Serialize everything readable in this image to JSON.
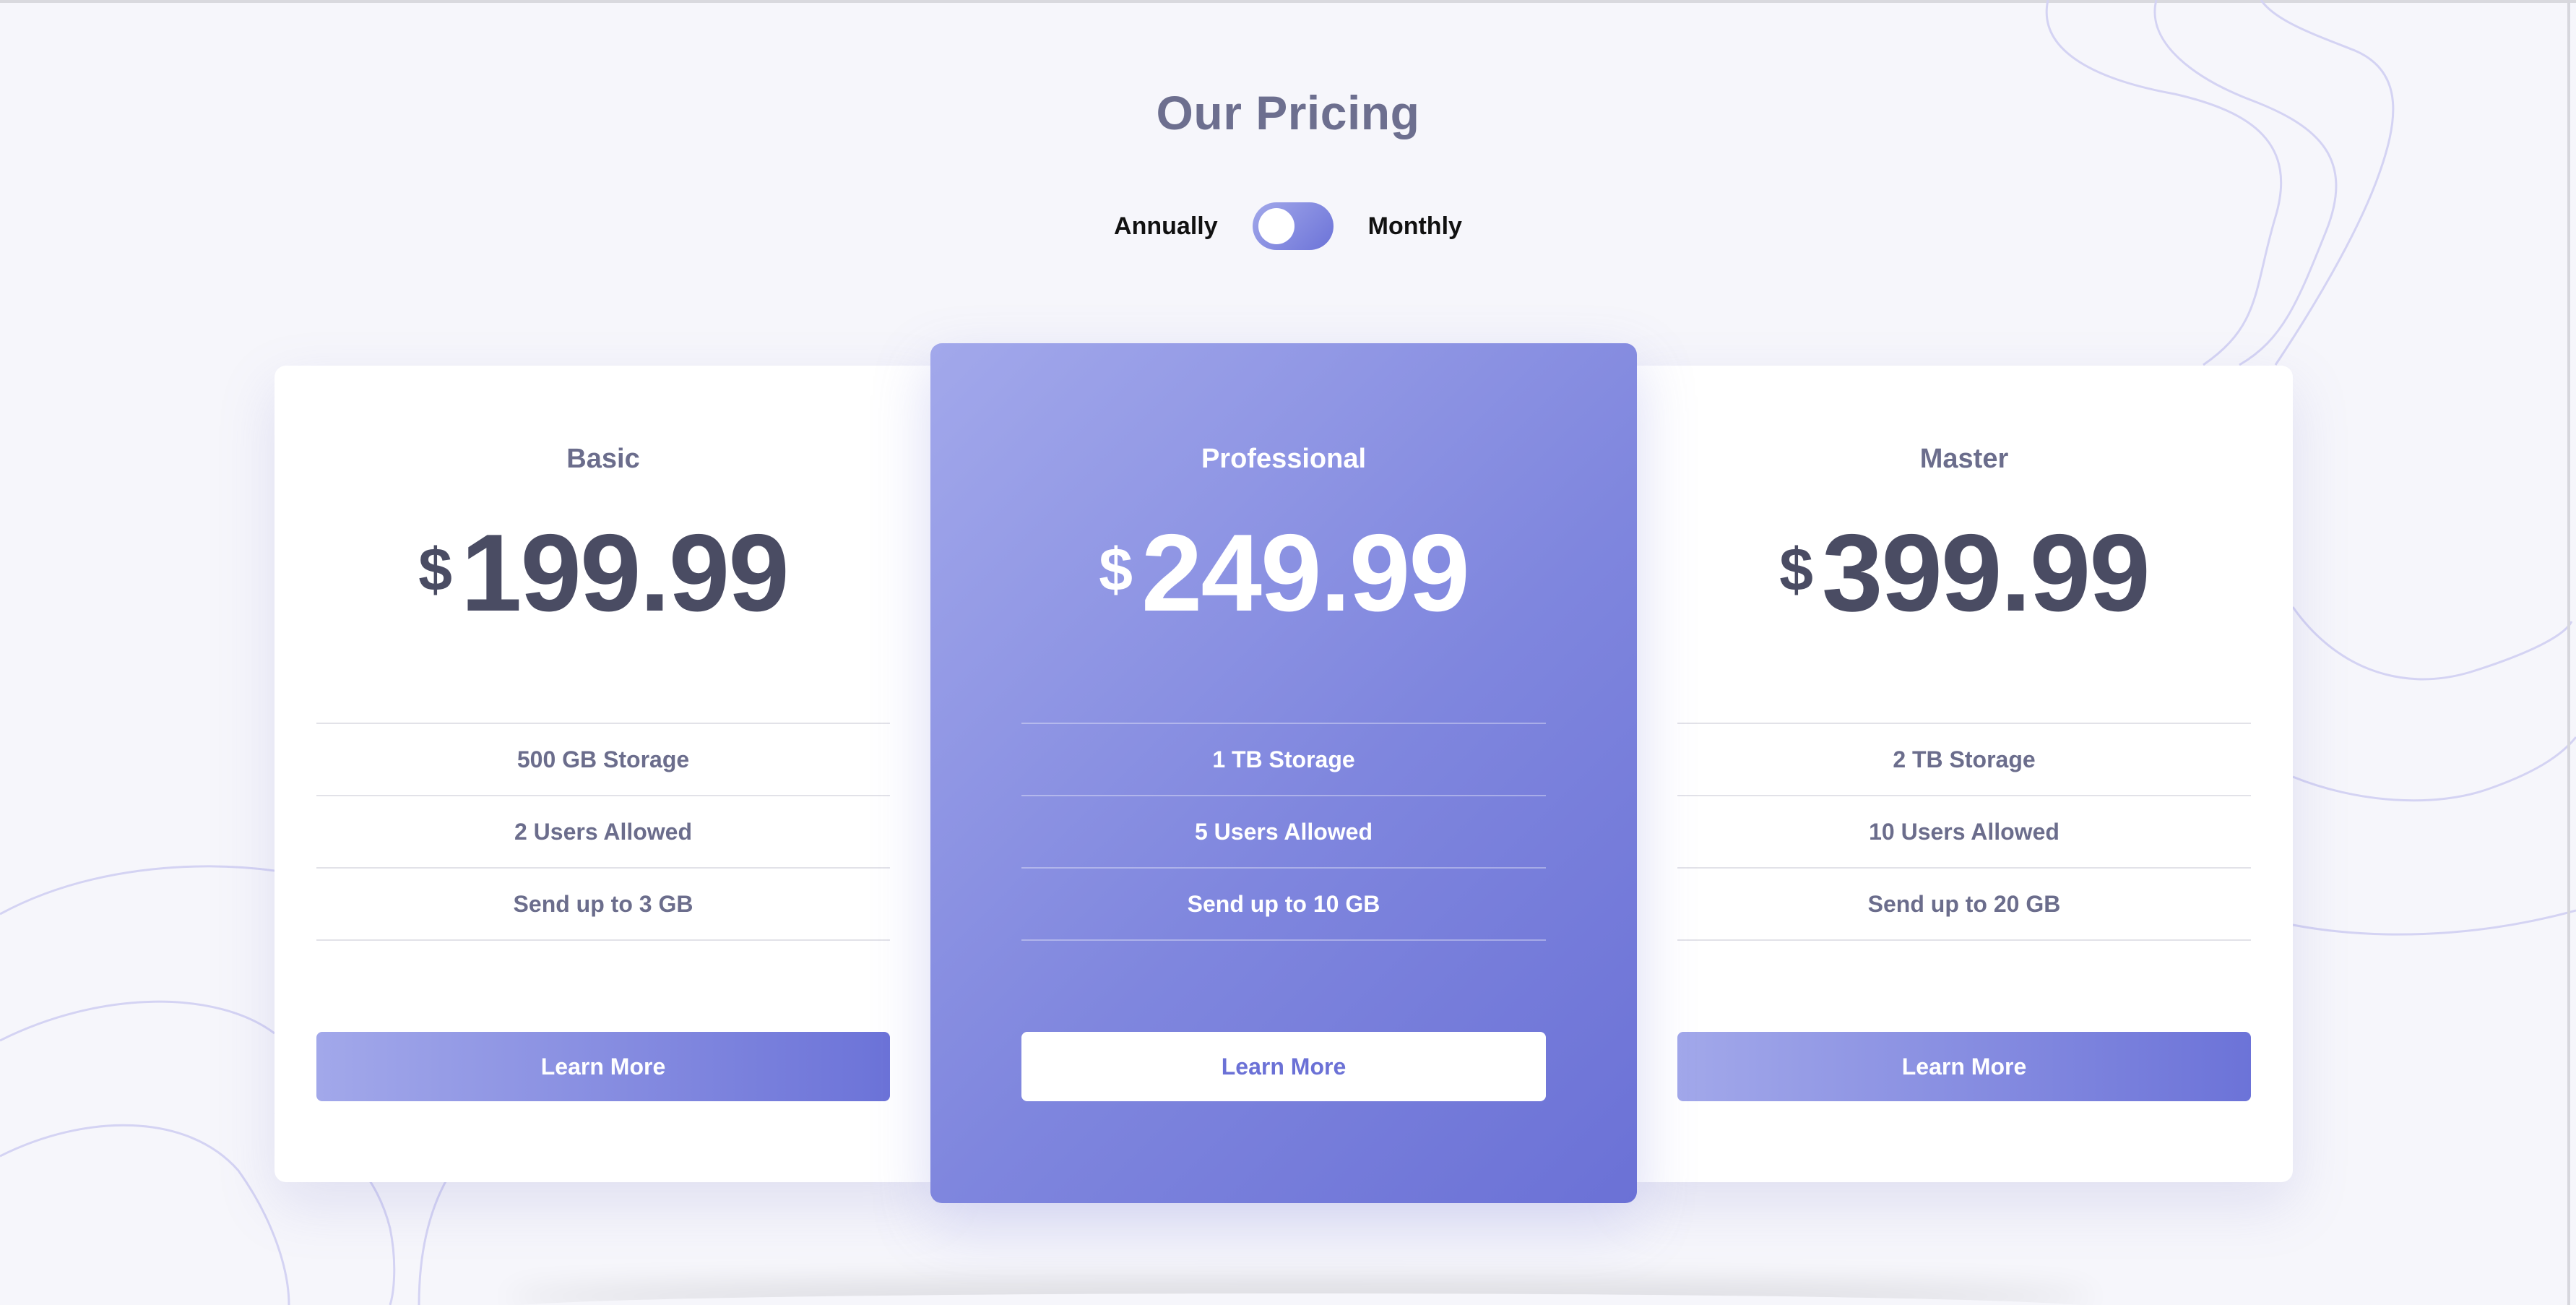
{
  "header": {
    "title": "Our Pricing"
  },
  "billing_toggle": {
    "left_label": "Annually",
    "right_label": "Monthly",
    "selected": "Annually"
  },
  "currency_symbol": "$",
  "plans": [
    {
      "name": "Basic",
      "price": "199.99",
      "features": [
        "500 GB Storage",
        "2 Users Allowed",
        "Send up to 3 GB"
      ],
      "button_label": "Learn More"
    },
    {
      "name": "Professional",
      "price": "249.99",
      "features": [
        "1 TB Storage",
        "5 Users Allowed",
        "Send up to 10 GB"
      ],
      "button_label": "Learn More"
    },
    {
      "name": "Master",
      "price": "399.99",
      "features": [
        "2 TB Storage",
        "10 Users Allowed",
        "Send up to 20 GB"
      ],
      "button_label": "Learn More"
    }
  ],
  "colors": {
    "background": "#f6f6fb",
    "accent_light": "#a2a8ea",
    "accent_dark": "#6c73d8",
    "heading_text": "#6d6f8f",
    "price_text": "#4a4c63"
  }
}
